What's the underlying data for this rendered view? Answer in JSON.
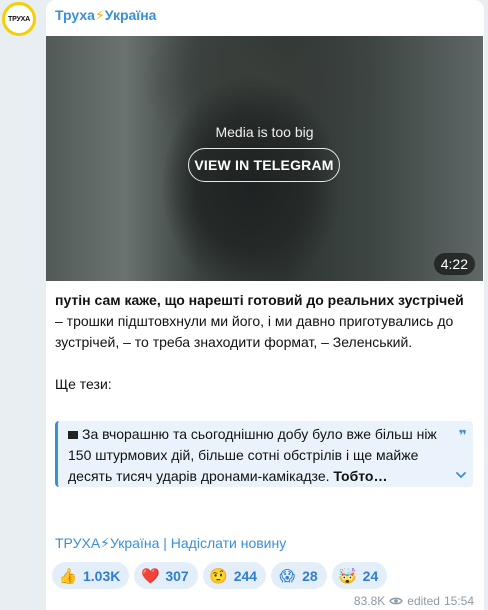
{
  "avatar": {
    "label": "ТРУХА"
  },
  "channel": {
    "name_prefix": "Труха",
    "bolt": "⚡",
    "name_suffix": "Україна"
  },
  "media": {
    "message": "Media is too big",
    "button": "VIEW IN TELEGRAM",
    "duration": "4:22"
  },
  "post": {
    "bold_lead": "путін сам каже, що нарешті готовий до реальних зустрічей",
    "lead_rest": " – трошки підштовхнули ми його, і ми давно приготувались до зустрічей, – то треба знаходити формат, – Зеленський.",
    "theses": "Ще тези:",
    "quote_text": "За вчорашню та сьогоднішню добу було вже більш ніж 150 штурмових дій, більше сотні обстрілів і ще майже десять тисяч ударів дронами-камікадзе. ",
    "quote_bold": "Тобто…"
  },
  "footer": {
    "link": "ТРУХА⚡Україна | Надіслати новину"
  },
  "reactions": [
    {
      "emoji": "👍",
      "count": "1.03K"
    },
    {
      "emoji": "❤️",
      "count": "307"
    },
    {
      "emoji": "🤨",
      "count": "244"
    },
    {
      "emoji": "😱",
      "count": "28"
    },
    {
      "emoji": "🤯",
      "count": "24"
    }
  ],
  "meta": {
    "views": "83.8K",
    "edited": "edited",
    "time": "15:54"
  },
  "colors": {
    "accent": "#3a8fd6",
    "bolt": "#f5b400",
    "avatar_ring": "#f5d000"
  }
}
